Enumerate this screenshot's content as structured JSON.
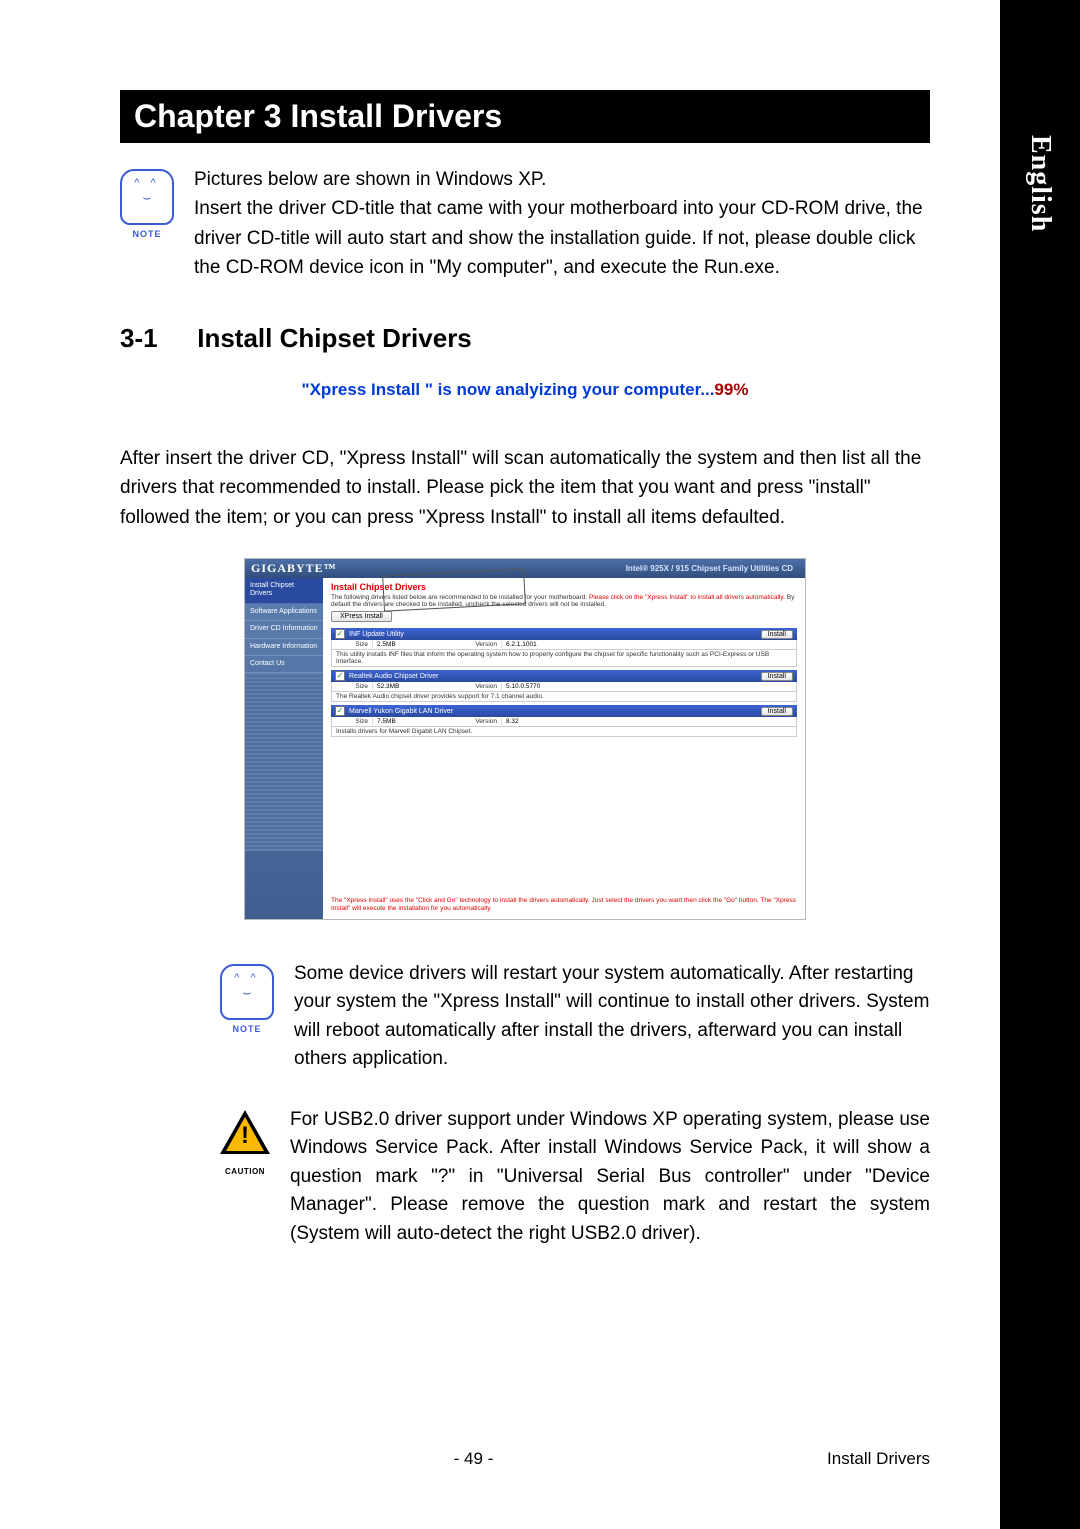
{
  "side_tab": "English",
  "chapter_bar": "Chapter 3  Install Drivers",
  "note1": "Pictures below are shown in Windows XP.\nInsert the driver CD-title that came with your motherboard into your CD-ROM drive, the driver CD-title will auto start and show the installation guide. If not, please double click the CD-ROM device icon in \"My computer\", and execute the Run.exe.",
  "note_label": "NOTE",
  "section_num": "3-1",
  "section_title": "Install Chipset Drivers",
  "analyze_line": "\"Xpress Install \" is now analyizing your computer...",
  "analyze_pct": "99%",
  "after_insert": "After insert the driver CD, \"Xpress Install\" will  scan automatically the system and then list all the drivers that recommended to install. Please pick the item that you want and press \"install\" followed the item; or you can press \"Xpress Install\" to install all items defaulted.",
  "screenshot": {
    "brand": "GIGABYTE™",
    "cd_title_a": "Intel®",
    "cd_title_b": " 925X / 915 ",
    "cd_title_c": "Chipset Family Utilities CD",
    "sidebar": {
      "install": "Install Chipset Drivers",
      "software": "Software Applications",
      "drivercd": "Driver CD Information",
      "hardware": "Hardware Information",
      "contact": "Contact Us"
    },
    "top": {
      "title": "Install Chipset Drivers",
      "desc_a": "The following drivers listed below are recommended to be installed for your motherboard. ",
      "desc_red": "Please click on the \"Xpress Install\" to install all drivers automatically.",
      "desc_b": " By default the drivers are checked to be installed, uncheck the selected drivers will not be installed.",
      "xpress_btn": "XPress Install"
    },
    "install_label": "Install",
    "size_label": "Size",
    "version_label": "Version",
    "drivers": [
      {
        "name": "INF Update Utility",
        "size": "2.5MB",
        "version": "6.2.1.1001",
        "desc": "This utility installs INF files that inform the operating system how to properly configure the chipset for specific functionality such as PCI-Express or USB Interface."
      },
      {
        "name": "Realtek Audio Chipset Driver",
        "size": "52.3MB",
        "version": "5.10.0.5770",
        "desc": "The Realtek Audio chipset driver provides support for 7.1 channel audio."
      },
      {
        "name": "Marvell Yukon Gigabit LAN Driver",
        "size": "7.5MB",
        "version": "8.32",
        "desc": "Installs drivers for Marvell Gigabit LAN Chipset."
      }
    ],
    "footer": "The \"Xpress Install\" uses the \"Click and Go\" technology to install the drivers automatically. Just select the drivers you want then click the \"Go\" button. The \"Xpress Install\" will execute the installation for you automatically."
  },
  "note2": "Some device drivers will restart your system automatically. After restarting your system the \"Xpress Install\" will continue to install other drivers. System will reboot automatically after install the drivers, afterward you can install others application.",
  "caution_label": "CAUTION",
  "caution_text": "For USB2.0 driver support under Windows XP operating system, please use Windows Service Pack. After install Windows Service Pack, it will show a question mark \"?\" in \"Universal Serial Bus controller\" under \"Device Manager\". Please remove the question mark and restart the system (System will auto-detect the right USB2.0 driver).",
  "footer_page": "- 49 -",
  "footer_title": "Install Drivers"
}
